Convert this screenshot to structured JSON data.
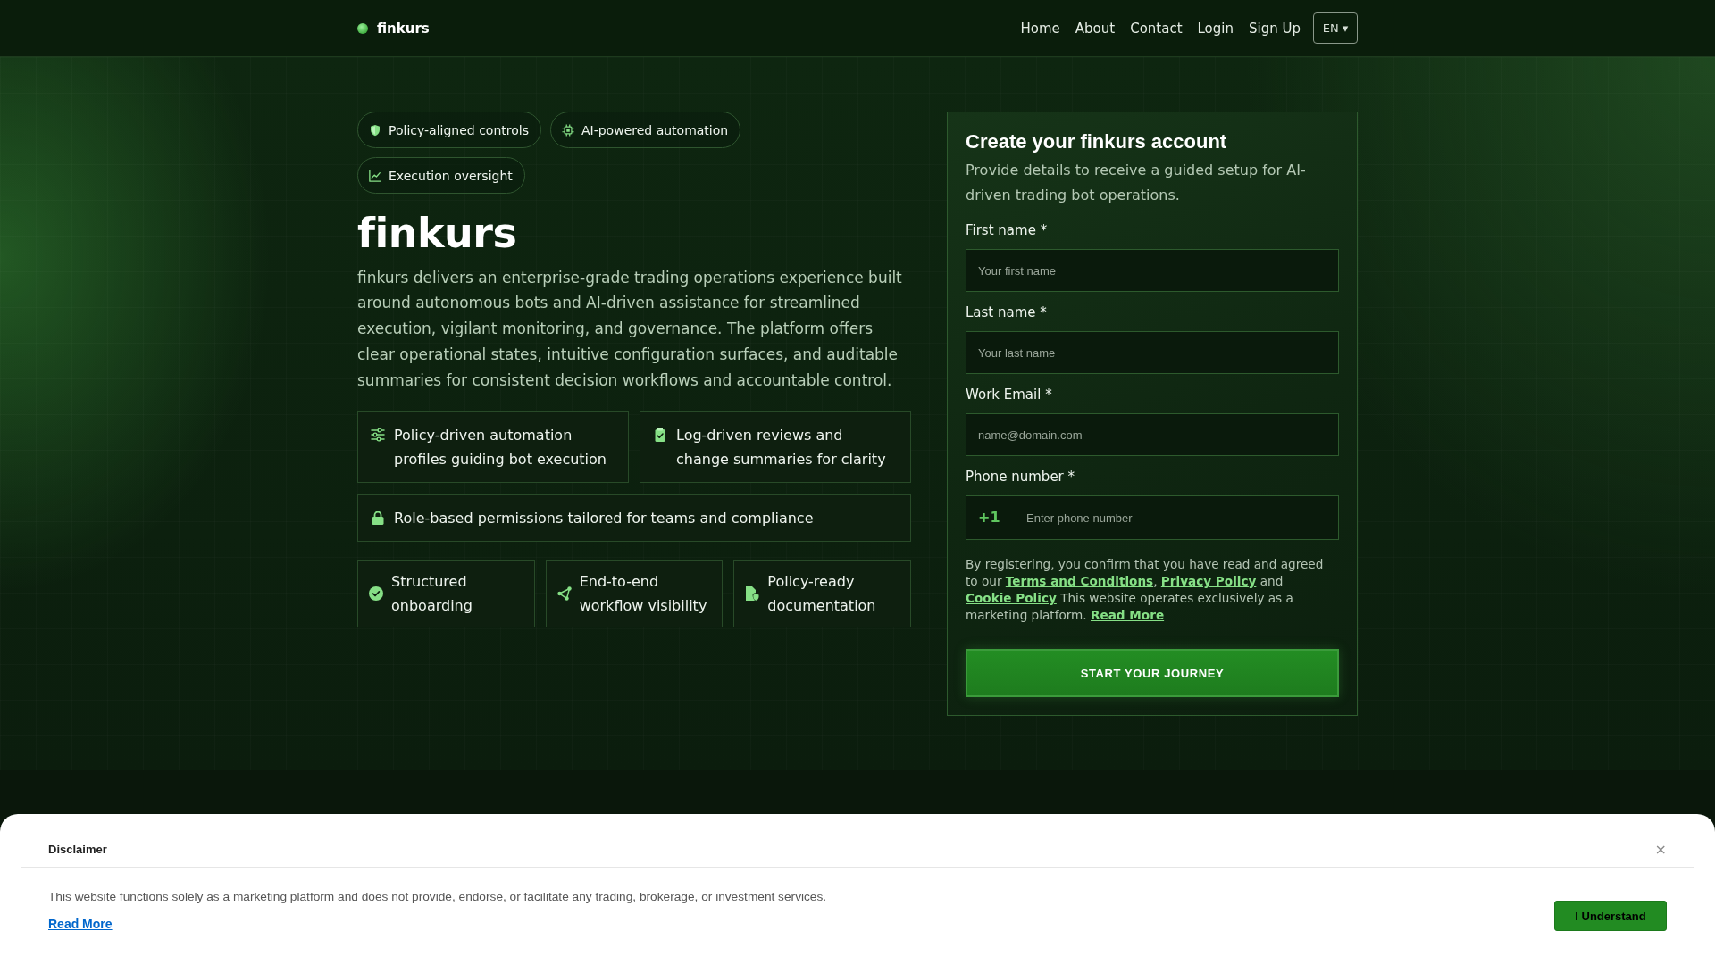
{
  "header": {
    "logo": "finkurs",
    "nav": [
      "Home",
      "About",
      "Contact",
      "Login",
      "Sign Up"
    ],
    "language": "EN ▾"
  },
  "hero": {
    "tags": [
      "Policy-aligned controls",
      "AI-powered automation",
      "Execution oversight"
    ],
    "title": "finkurs",
    "description": "finkurs delivers an enterprise-grade trading operations experience built around autonomous bots and AI-driven assistance for streamlined execution, vigilant monitoring, and governance. The platform offers clear operational states, intuitive configuration surfaces, and auditable summaries for consistent decision workflows and accountable control.",
    "features": [
      "Policy-driven automation profiles guiding bot execution",
      "Log-driven reviews and change summaries for clarity",
      "Role-based permissions tailored for teams and compliance"
    ],
    "highlights": [
      "Structured onboarding",
      "End-to-end workflow visibility",
      "Policy-ready documentation"
    ]
  },
  "signup_form": {
    "title": "Create your finkurs account",
    "subtitle": "Provide details to receive a guided setup for AI-driven trading bot operations.",
    "fields": [
      {
        "kind": "text",
        "label": "First name *",
        "placeholder": "Your first name"
      },
      {
        "kind": "text",
        "label": "Last name *",
        "placeholder": "Your last name"
      },
      {
        "kind": "text",
        "label": "Work Email *",
        "placeholder": "name@domain.com"
      },
      {
        "kind": "phone",
        "label": "Phone number *",
        "prefix": "+1",
        "placeholder": "Enter phone number"
      }
    ],
    "consent": [
      {
        "kind": "text",
        "text": "By registering, you confirm that you have read and agreed to our "
      },
      {
        "kind": "link",
        "text": "Terms and Conditions"
      },
      {
        "kind": "text",
        "text": ", "
      },
      {
        "kind": "link",
        "text": "Privacy Policy"
      },
      {
        "kind": "text",
        "text": " and "
      },
      {
        "kind": "link",
        "text": "Cookie Policy"
      },
      {
        "kind": "text",
        "text": " This website operates exclusively as a marketing platform. "
      },
      {
        "kind": "link",
        "text": "Read More"
      }
    ],
    "submit": "START YOUR JOURNEY"
  },
  "disclaimer": {
    "title": "Disclaimer",
    "close": "×",
    "text": "This website functions solely as a marketing platform and does not provide, endorse, or facilitate any trading, brokerage, or investment services.",
    "read_more": "Read More",
    "button": "I Understand"
  }
}
